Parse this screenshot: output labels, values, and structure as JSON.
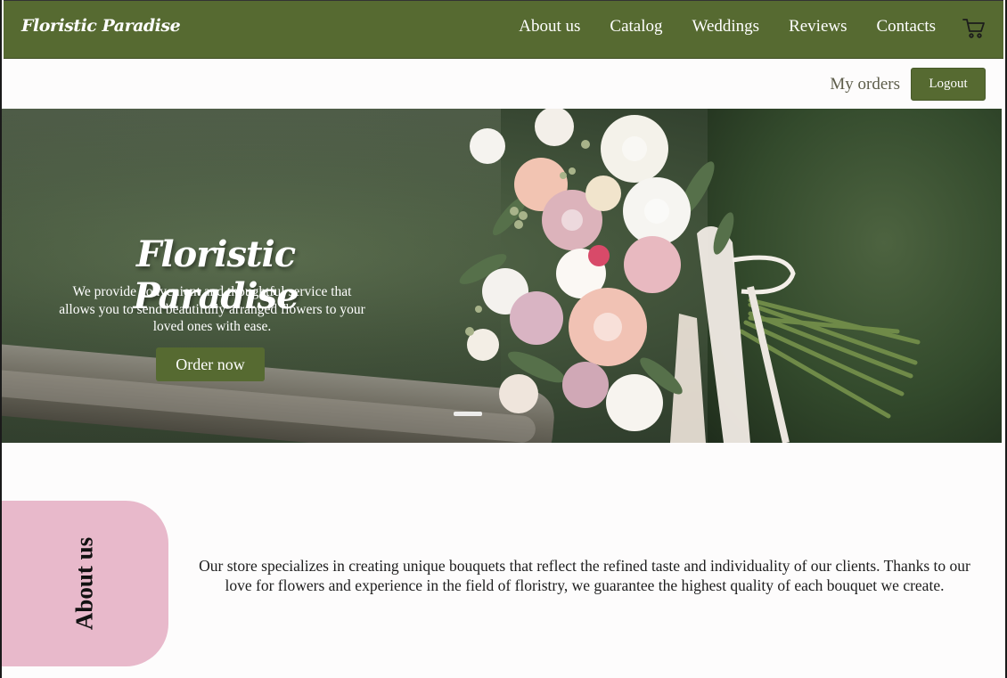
{
  "header": {
    "logo": "Floristic Paradise",
    "nav": [
      {
        "label": "About us"
      },
      {
        "label": "Catalog"
      },
      {
        "label": "Weddings"
      },
      {
        "label": "Reviews"
      },
      {
        "label": "Contacts"
      }
    ],
    "cart_icon": "cart-icon"
  },
  "account": {
    "my_orders": "My orders",
    "logout": "Logout"
  },
  "hero": {
    "title": "Floristic Paradise",
    "description": "We provide convenient and thoughtful service that allows you to send beautifully arranged flowers to your loved ones with ease.",
    "cta": "Order now"
  },
  "about": {
    "heading": "About us",
    "text": "Our store specializes in creating unique bouquets that reflect the refined taste and individuality of our clients. Thanks to our love for flowers and experience in the field of floristry, we guarantee the highest quality of each bouquet we create."
  },
  "colors": {
    "brand_green": "#566a31",
    "about_pink": "#e8b9cb",
    "page_bg": "#fdfcfc"
  }
}
